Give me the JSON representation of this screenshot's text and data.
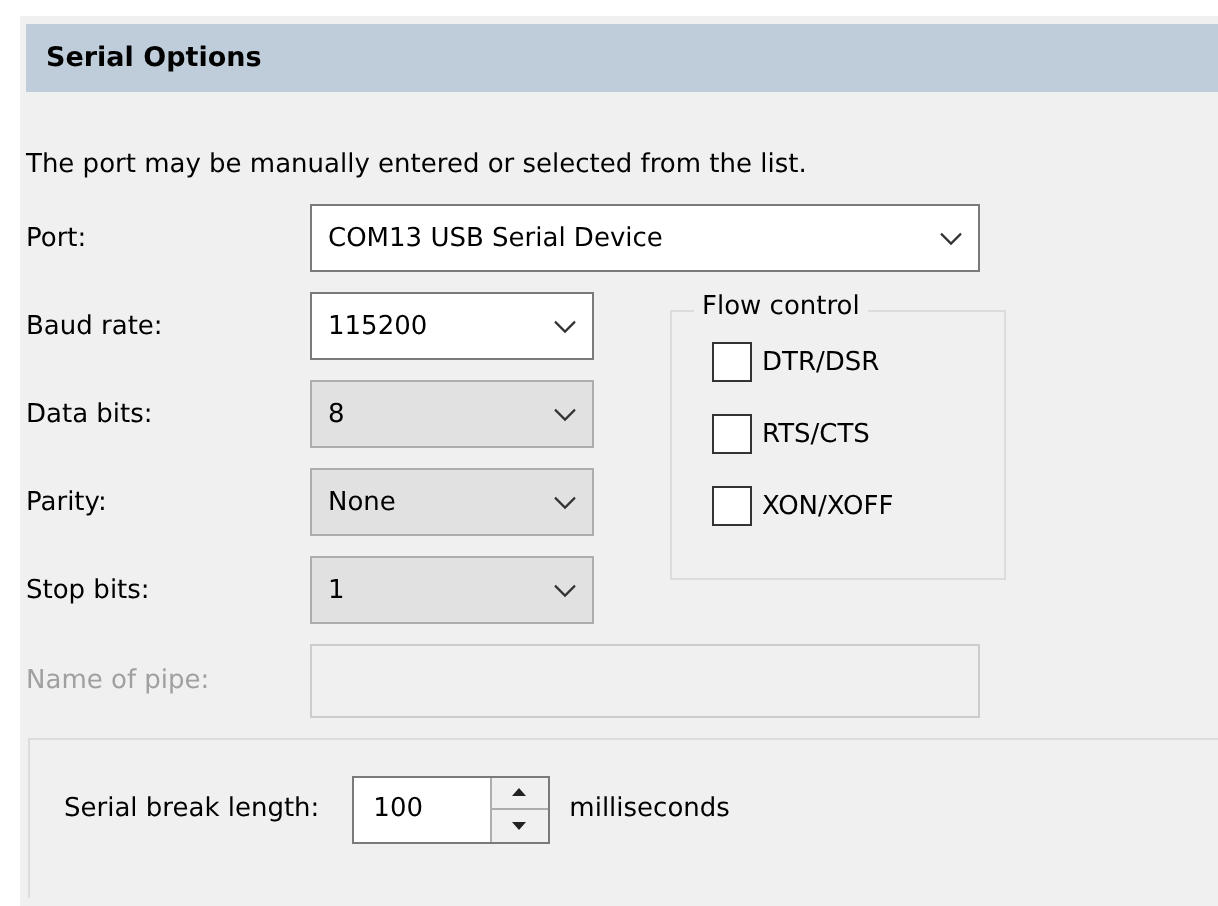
{
  "section_title": "Serial Options",
  "instructions": "The port may be manually entered or selected from the list.",
  "fields": [
    {
      "label": "Port:",
      "value": "COM13 USB Serial Device",
      "kind": "editable",
      "wide": true
    },
    {
      "label": "Baud rate:",
      "value": "115200",
      "kind": "editable",
      "wide": false
    },
    {
      "label": "Data bits:",
      "value": "8",
      "kind": "list",
      "wide": false
    },
    {
      "label": "Parity:",
      "value": "None",
      "kind": "list",
      "wide": false
    },
    {
      "label": "Stop bits:",
      "value": "1",
      "kind": "list",
      "wide": false
    }
  ],
  "flow_control": {
    "title": "Flow control",
    "options": [
      {
        "label": "DTR/DSR",
        "checked": false
      },
      {
        "label": "RTS/CTS",
        "checked": false
      },
      {
        "label": "XON/XOFF",
        "checked": false
      }
    ]
  },
  "pipe": {
    "label": "Name of pipe:",
    "disabled": true
  },
  "break_length": {
    "label": "Serial break length:",
    "value": "100",
    "unit": "milliseconds"
  }
}
